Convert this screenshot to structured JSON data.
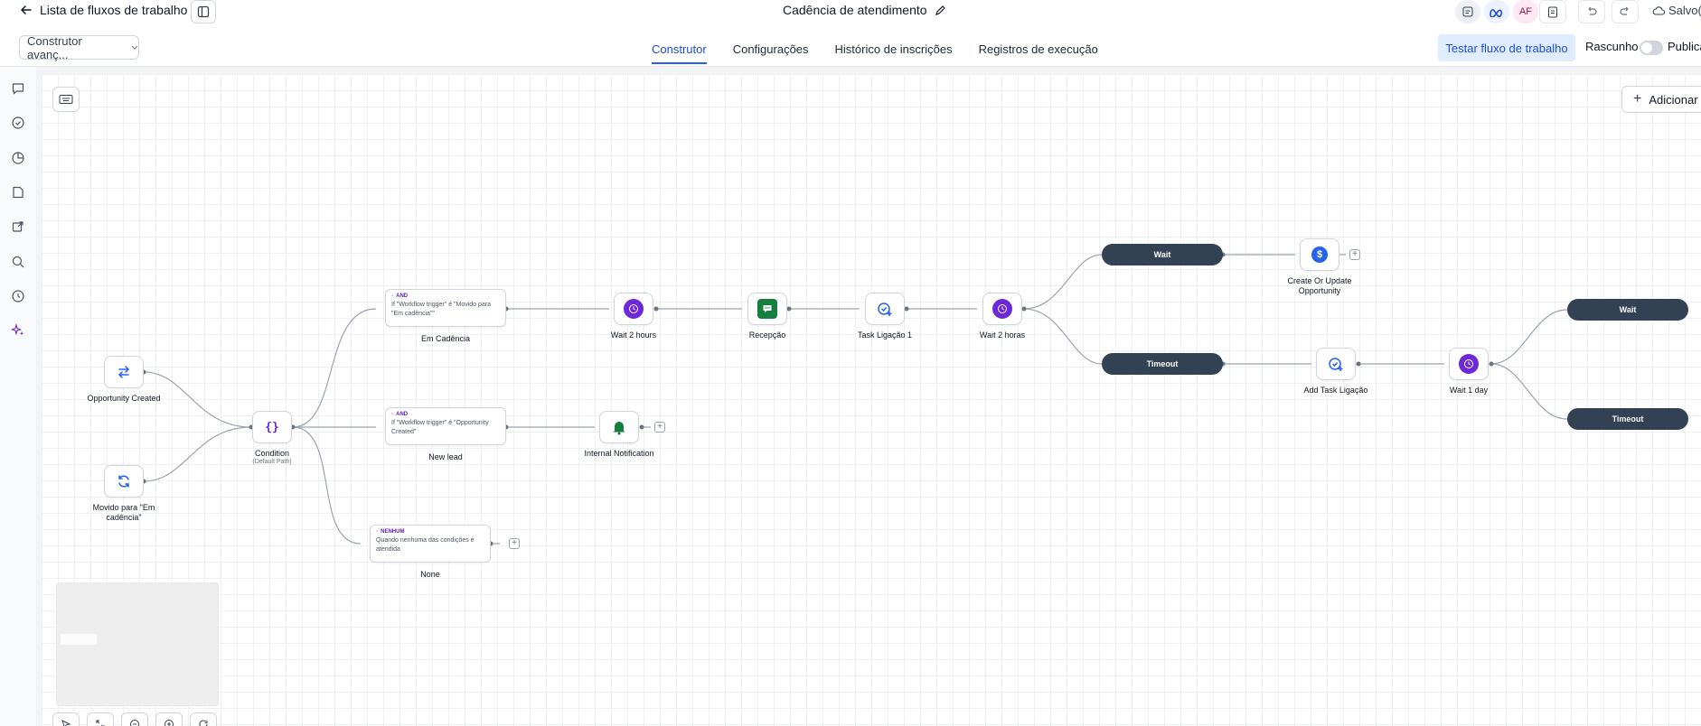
{
  "header": {
    "back_label": "Lista de fluxos de trabalho",
    "workflow_title": "Cadência de atendimento",
    "avatar_initials": "AF",
    "saved_label": "Salvo(a)"
  },
  "toolbar": {
    "builder_select": "Construtor avanç...",
    "tabs": [
      {
        "label": "Construtor",
        "active": true
      },
      {
        "label": "Configurações"
      },
      {
        "label": "Histórico de inscrições"
      },
      {
        "label": "Registros de execução"
      }
    ],
    "test_button": "Testar fluxo de trabalho",
    "draft_label": "Rascunho",
    "publish_label": "Publicar"
  },
  "canvas": {
    "add_button": "Adicionar",
    "triggers": {
      "opportunity_created": "Opportunity Created",
      "moved_to": "Movido para \"Em cadência\""
    },
    "condition": {
      "label": "Condition",
      "sub": "(Default Path)"
    },
    "branches": [
      {
        "tag": "AND",
        "text": "If \"Workflow trigger\" é \"Movido para \"Em cadência\"\"",
        "label": "Em Cadência"
      },
      {
        "tag": "AND",
        "text": "If \"Workflow trigger\" é \"Opportunity Created\"",
        "label": "New lead"
      },
      {
        "tag": "NENHUM",
        "text": "Quando nenhuma das condições é atendida",
        "label": "None"
      }
    ],
    "actions": {
      "wait_2_hours": "Wait 2 hours",
      "recepcao": "Recepção",
      "task_ligacao_1": "Task Ligação 1",
      "wait_2_horas": "Wait 2 horas",
      "wait": "Wait",
      "timeout": "Timeout",
      "create_update_opportunity": "Create Or Update Opportunity",
      "add_task_ligacao": "Add Task Ligação",
      "wait_1_day": "Wait 1 day",
      "internal_notification": "Internal Notification"
    }
  },
  "colors": {
    "accent": "#2563eb",
    "purple": "#6d28d9",
    "green": "#15803d",
    "pill": "#334155"
  }
}
